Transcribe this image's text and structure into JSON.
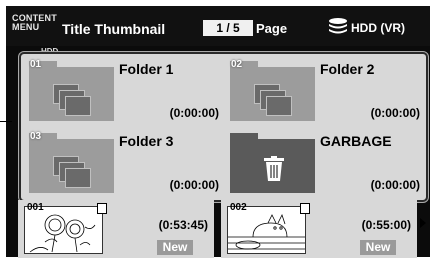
{
  "header": {
    "menu_logo_line1": "CONTENT",
    "menu_logo_line2": "MENU",
    "title": "Title Thumbnail",
    "page_indicator": "1 / 5",
    "page_label": "Page",
    "drive_label": "HDD (VR)",
    "drive_sub": "HDD"
  },
  "folders": [
    {
      "num": "01",
      "name": "Folder 1",
      "duration": "(0:00:00)",
      "icon": "folder-icon"
    },
    {
      "num": "02",
      "name": "Folder 2",
      "duration": "(0:00:00)",
      "icon": "folder-icon"
    },
    {
      "num": "03",
      "name": "Folder 3",
      "duration": "(0:00:00)",
      "icon": "folder-icon"
    },
    {
      "num": "",
      "name": "GARBAGE",
      "duration": "(0:00:00)",
      "icon": "trash-icon"
    }
  ],
  "titles": [
    {
      "num": "001",
      "duration": "(0:53:45)",
      "badge": "New"
    },
    {
      "num": "002",
      "duration": "(0:55:00)",
      "badge": "New"
    }
  ],
  "colors": {
    "screen_bg": "#0b0b0b",
    "panel_bg": "#d8d8d8",
    "folder_gray": "#9c9c9c",
    "garbage_gray": "#5a5a5a"
  }
}
